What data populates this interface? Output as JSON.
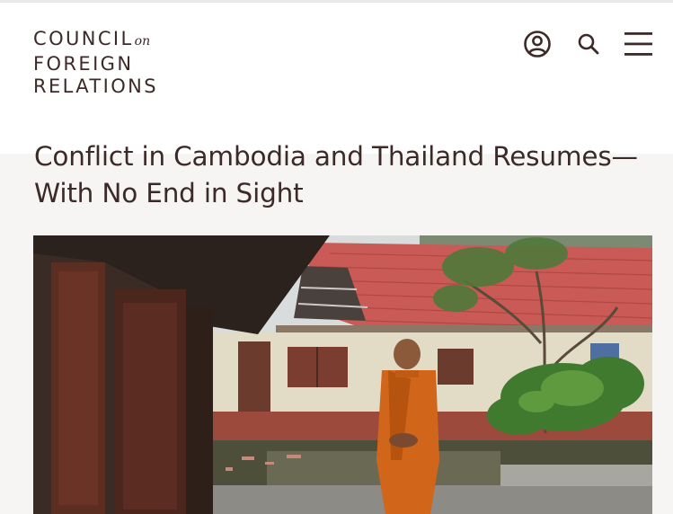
{
  "header": {
    "logo": {
      "line1": "COUNCIL",
      "on": "on",
      "line2": "FOREIGN",
      "line3": "RELATIONS"
    },
    "icons": [
      "account-icon",
      "search-icon",
      "menu-icon"
    ]
  },
  "article": {
    "headline_line1": "Conflict in Cambodia and Thailand Resumes—",
    "headline_line2": "With No End in Sight"
  },
  "colors": {
    "text": "#3b2a28",
    "article_bg": "#f6f5f4",
    "roof_red": "#c95a55",
    "robe_orange": "#d1661a"
  }
}
